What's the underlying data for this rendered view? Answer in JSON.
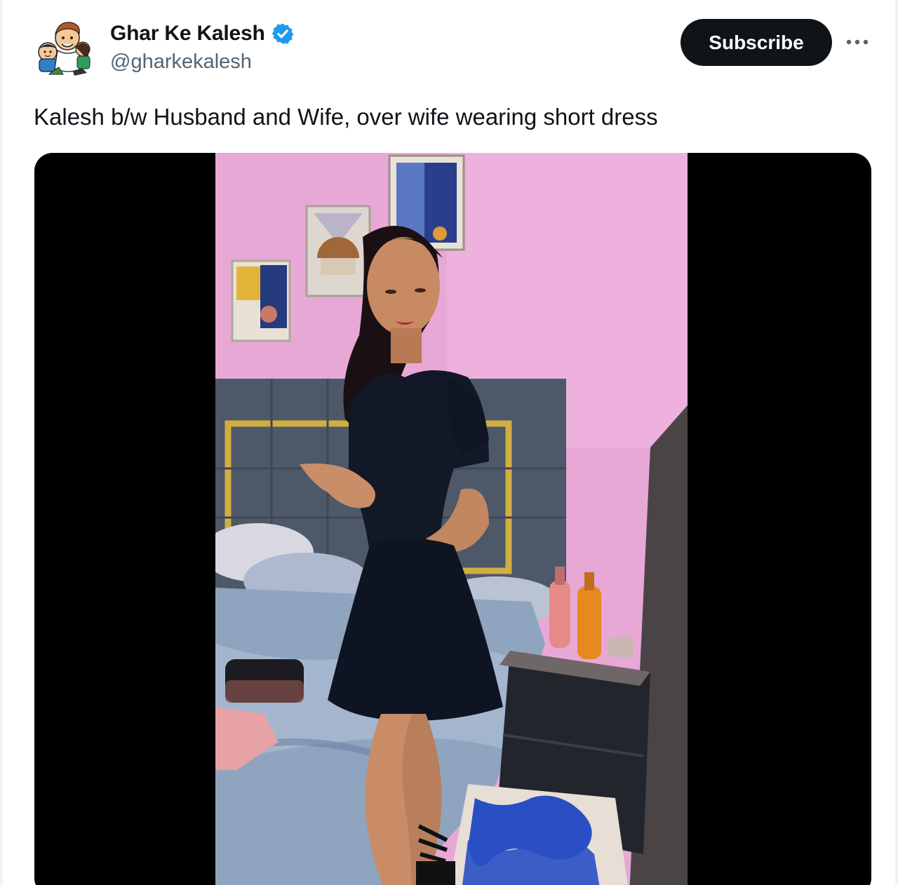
{
  "author": {
    "display_name": "Ghar Ke Kalesh",
    "handle": "@gharkekalesh",
    "verified": true,
    "avatar_icon": "cartoon-avatar-icon"
  },
  "actions": {
    "subscribe_label": "Subscribe",
    "more_icon": "more-dots-icon"
  },
  "tweet": {
    "text": "Kalesh b/w Husband and Wife, over wife wearing short dress"
  },
  "media": {
    "type": "video",
    "accent_colors": {
      "wall": "#e7a6d4",
      "dress": "#0f1624",
      "headboard": "#4b5666",
      "gold_trim": "#c9a43a",
      "rug_blue": "#2a4fc4"
    }
  },
  "colors": {
    "button_bg": "#0f1419",
    "verified_blue": "#1d9bf0",
    "handle_gray": "#536471"
  }
}
